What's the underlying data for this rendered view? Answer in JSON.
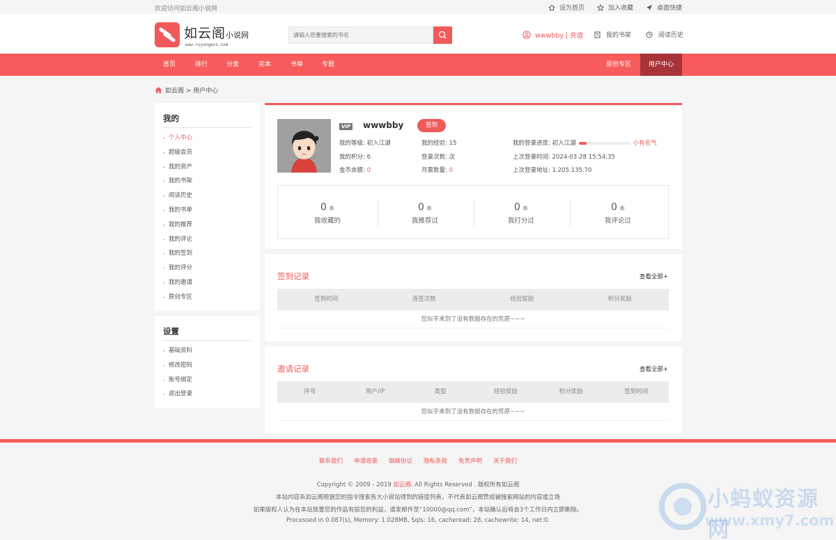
{
  "topbar": {
    "welcome": "欢迎访问如云阁小说网",
    "set_home": "设为首页",
    "add_fav": "加入收藏",
    "desktop": "桌面快捷"
  },
  "header": {
    "logo_big": "如云阁",
    "logo_small": "小说网",
    "logo_url": "www.ruyungexs.com",
    "search_placeholder": "请输入您要搜索的书名",
    "user": "wwwbby | 充值",
    "bookshelf": "我的书架",
    "history": "阅读历史"
  },
  "nav": {
    "items": [
      "首页",
      "排行",
      "分类",
      "完本",
      "书单",
      "专题"
    ],
    "original": "原创专区",
    "user_center": "用户中心"
  },
  "breadcrumb": "如云阁 > 用户中心",
  "sidebar": {
    "mine_title": "我的",
    "mine_items": [
      "个人中心",
      "超级会员",
      "我的资产",
      "我的书架",
      "阅读历史",
      "我的书单",
      "我的推荐",
      "我的评论",
      "我的签到",
      "我的评分",
      "我的邀请",
      "原创专区"
    ],
    "settings_title": "设置",
    "settings_items": [
      "基础资料",
      "修改密码",
      "账号绑定",
      "退出登录"
    ]
  },
  "profile": {
    "vip": "VIP",
    "username": "wwwbby",
    "sign_button": "签到",
    "level_label": "我的等级:",
    "level_value": "初入江湖",
    "exp_label": "我的经验:",
    "exp_value": "15",
    "progress_label": "我的登录进度:",
    "progress_from": "初入江湖",
    "progress_to": "小有名气",
    "progress_fraction": 0.15,
    "points_label": "我的积分:",
    "points_value": "6",
    "login_count_label": "登录次数:",
    "login_count_value": "次",
    "last_login_label": "上次登录时间:",
    "last_login_value": "2024-03-28 15:54:35",
    "coins_label": "金币余额:",
    "coins_value": "0",
    "monthly_label": "月票数量:",
    "monthly_value": "0",
    "last_ip_label": "上次登录地址:",
    "last_ip_value": "1.205.135.70",
    "stats": [
      {
        "num": "0",
        "unit": "本",
        "label": "我收藏的"
      },
      {
        "num": "0",
        "unit": "本",
        "label": "我推荐过"
      },
      {
        "num": "0",
        "unit": "本",
        "label": "我打分过"
      },
      {
        "num": "0",
        "unit": "本",
        "label": "我评论过"
      }
    ]
  },
  "sign_records": {
    "title": "签到记录",
    "more": "查看全部+",
    "columns": [
      "签到时间",
      "连签次数",
      "经验奖励",
      "积分奖励"
    ],
    "empty": "您似乎来到了没有数据存在的荒原~~~"
  },
  "invite_records": {
    "title": "邀请记录",
    "more": "查看全部+",
    "columns": [
      "序号",
      "用户/IP",
      "类型",
      "经验奖励",
      "积分奖励",
      "签到时间"
    ],
    "empty": "您似乎来到了没有数据存在的荒原~~~"
  },
  "footer": {
    "links": [
      "联系我们",
      "申请收录",
      "蜘蛛协议",
      "隐私条款",
      "免责声明",
      "关于我们"
    ],
    "copyright_pre": "Copyright © 2009 - 2019 ",
    "copyright_site": "如云阁",
    "copyright_post": ". All Rights Reserved . 版权所有如云阁",
    "line2": "本站内容系如云阁根据您的指令搜索各大小说站得到的链接列表，不代表如云阁赞成被搜索网站的内容或立场",
    "line3": "如果版权人认为在本站放置您的作品有损您的利益，请发邮件至“10000@qq.com”，本站确认后将会3个工作日内立即删除。",
    "line4": "Processed in 0.087(s), Memory: 1.028MB, Sqls: 16, cacheread: 28, cachewrite: 14, net:0."
  },
  "watermark": {
    "text": "小蚂蚁资源网",
    "url": "www.xmy7.com"
  }
}
